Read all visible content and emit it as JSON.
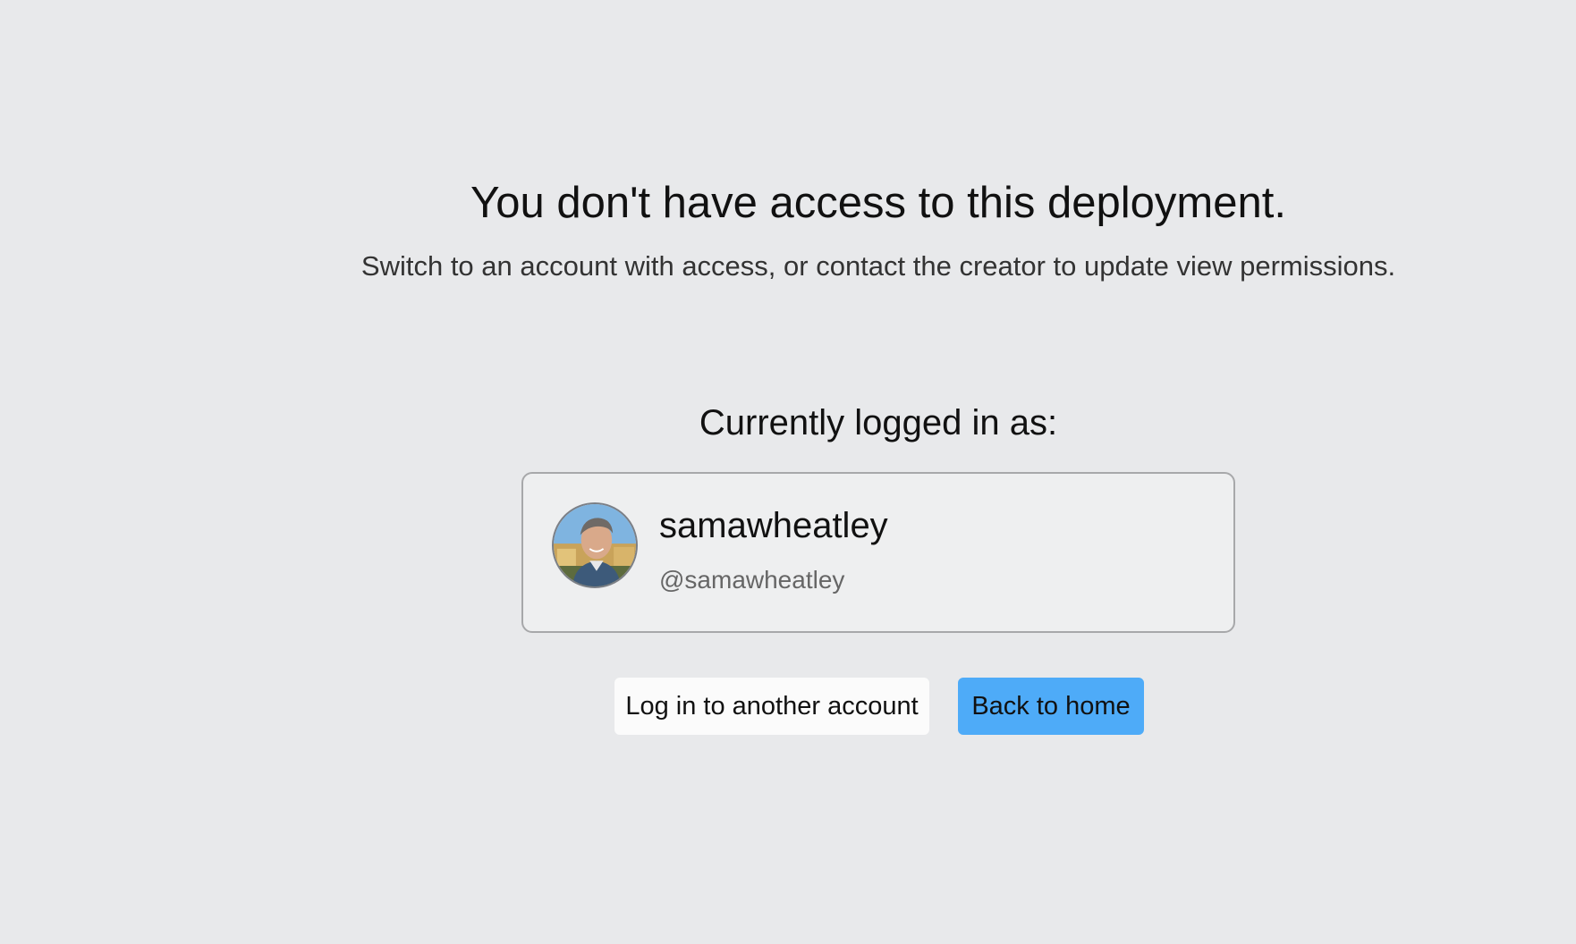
{
  "message": {
    "title": "You don't have access to this deployment.",
    "subtitle": "Switch to an account with access, or contact the creator to update view permissions."
  },
  "account": {
    "label": "Currently logged in as:",
    "display_name": "samawheatley",
    "handle": "@samawheatley",
    "avatar_icon": "user-avatar-photo"
  },
  "actions": {
    "switch_account_label": "Log in to another account",
    "home_label": "Back to home"
  },
  "colors": {
    "background": "#e8e9eb",
    "primary_button": "#4eabf8",
    "secondary_button": "#fbfbfb",
    "card_border": "#a7a8aa"
  }
}
